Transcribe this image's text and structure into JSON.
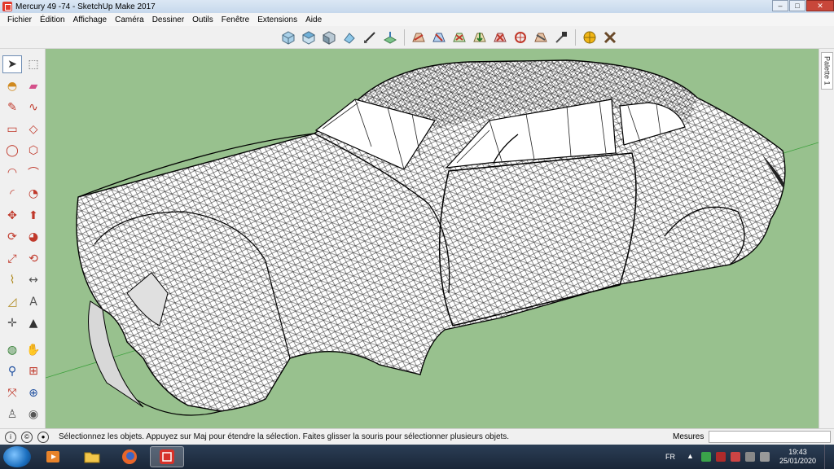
{
  "window": {
    "title": "Mercury 49 -74 - SketchUp Make 2017"
  },
  "menu": [
    "Fichier",
    "Édition",
    "Affichage",
    "Caméra",
    "Dessiner",
    "Outils",
    "Fenêtre",
    "Extensions",
    "Aide"
  ],
  "toolbar": {
    "view_buttons": [
      "iso-view-icon",
      "top-view-icon",
      "front-view-icon",
      "right-view-icon",
      "back-view-icon",
      "left-view-icon"
    ],
    "sandbox_buttons": [
      "sandbox-contours-icon",
      "sandbox-scratch-icon",
      "sandbox-smoove-icon",
      "sandbox-stamp-icon",
      "sandbox-drape-icon",
      "sandbox-add-detail-icon",
      "sandbox-flip-edge-icon",
      "extension-warehouse-icon",
      "3d-warehouse-icon",
      "geo-location-icon",
      "extension-manager-icon"
    ]
  },
  "left_tools": [
    "select-icon",
    "component-icon",
    "paint-bucket-icon",
    "eraser-icon",
    "pencil-icon",
    "freehand-icon",
    "rectangle-icon",
    "rotated-rectangle-icon",
    "circle-icon",
    "polygon-icon",
    "arc-icon",
    "two-point-arc-icon",
    "three-point-arc-icon",
    "pie-icon",
    "move-icon",
    "push-pull-icon",
    "rotate-icon",
    "follow-me-icon",
    "scale-icon",
    "offset-icon",
    "tape-measure-icon",
    "dimension-icon",
    "protractor-icon",
    "text-icon",
    "axes-icon",
    "3d-text-icon",
    "orbit-icon",
    "pan-icon",
    "zoom-icon",
    "zoom-window-icon",
    "zoom-extents-icon",
    "previous-view-icon",
    "position-camera-icon",
    "look-around-icon"
  ],
  "palette_tab": "Palette 1",
  "status": {
    "message": "Sélectionnez les objets. Appuyez sur Maj pour étendre la sélection. Faites glisser la souris pour sélectionner plusieurs objets.",
    "measures_label": "Mesures",
    "measures_value": ""
  },
  "taskbar": {
    "apps": [
      "media-player-icon",
      "file-explorer-icon",
      "firefox-icon",
      "sketchup-icon"
    ],
    "language": "FR",
    "time": "19:43",
    "date": "25/01/2020"
  },
  "colors": {
    "viewport_bg": "#98c18e",
    "mesh_line": "#111111",
    "car_surface": "#ffffff",
    "taskbar": "#1f2d40"
  }
}
